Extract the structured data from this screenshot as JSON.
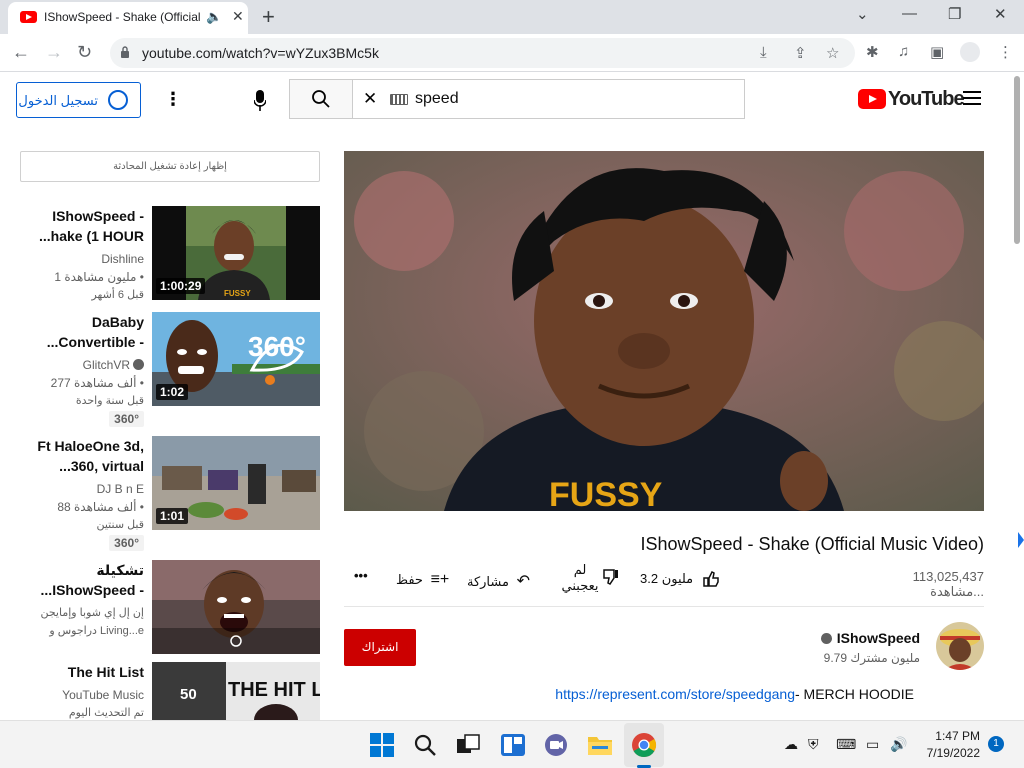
{
  "browser": {
    "tab_title": "IShowSpeed - Shake (Official",
    "speaker_glyph": "🔈",
    "close_glyph": "✕",
    "newtab_glyph": "+",
    "url": "youtube.com/watch?v=wYZux3BMc5k",
    "window_controls": [
      "⌄",
      "—",
      "❐",
      "✕"
    ]
  },
  "youtube": {
    "signin_label": "تسجيل الدخول",
    "search_query": "speed",
    "logo_text": "YouTube",
    "chat_replay": "إظهار إعادة تشغيل المحادثة",
    "recommendations": [
      {
        "line1": "IShowSpeed -",
        "line2": "...hake (1 HOUR",
        "channel": "Dishline",
        "meta1": "1 مليون مشاهدة •",
        "meta2": "قبل 6 أشهر",
        "duration": "1:00:29",
        "badge": ""
      },
      {
        "line1": "DaBaby",
        "line2": "...Convertible -",
        "channel": "GlitchVR",
        "meta1": "277 ألف مشاهدة •",
        "meta2": "قبل سنة واحدة",
        "duration": "1:02",
        "badge": "360°"
      },
      {
        "line1": "Ft HaloeOne 3d,",
        "line2": "...360, virtual",
        "channel": "DJ B n E",
        "meta1": "88 ألف مشاهدة •",
        "meta2": "قبل سنتين",
        "duration": "1:01",
        "badge": "360°"
      },
      {
        "line1": "تشكيلة",
        "line2": "...IShowSpeed -",
        "channel": "إن إل إي شوبا وإمايجن",
        "meta1": "دراجوس و Living...e",
        "meta2": "",
        "duration": "",
        "badge": ""
      },
      {
        "line1": "The Hit List",
        "line2": "",
        "channel": "YouTube Music",
        "meta1": "تم التحديث اليوم",
        "meta2": "",
        "duration": "",
        "badge": "",
        "count": "50",
        "thumb_text": "THE HIT LIST"
      }
    ],
    "thumb_360_text": "360°",
    "video": {
      "title": "IShowSpeed - Shake (Official Music Video)",
      "views": "113,025,437 مشاهدة...",
      "likes": "3.2 مليون",
      "dislike_label_1": "لم",
      "dislike_label_2": "يعجبني",
      "share_label": "مشاركة",
      "save_label": "حفظ",
      "more_glyph": "•••",
      "shirt_text": "FUSSY"
    },
    "channel": {
      "name": "IShowSpeed",
      "subscribers": "9.79 مليون مشترك",
      "subscribe_label": "اشتراك"
    },
    "description": {
      "prefix": "- MERCH HOODIE",
      "link": "https://represent.com/store/speedgang"
    }
  },
  "taskbar": {
    "time": "1:47 PM",
    "date": "7/19/2022",
    "notifications": "1"
  },
  "colors": {
    "accent_blue": "#065fd4",
    "youtube_red": "#ff0000",
    "subscribe_red": "#cc0000"
  }
}
